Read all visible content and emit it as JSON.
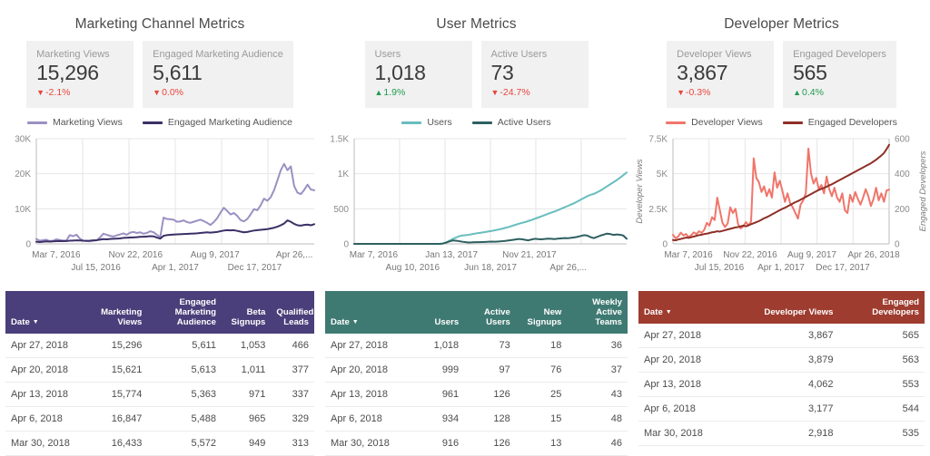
{
  "panels": [
    {
      "title": "Marketing Channel Metrics",
      "accent": "#4a3f7a",
      "kpis": [
        {
          "label": "Marketing Views",
          "value": "15,296",
          "delta": "-2.1%",
          "direction": "down",
          "arrow": "▼"
        },
        {
          "label": "Engaged Marketing Audience",
          "value": "5,611",
          "delta": "0.0%",
          "direction": "down",
          "arrow": "▼"
        }
      ],
      "legend": [
        {
          "label": "Marketing Views",
          "color": "#9b90c2"
        },
        {
          "label": "Engaged Marketing Audience",
          "color": "#3b2f66"
        }
      ],
      "table": {
        "columns": [
          "Date",
          "Marketing Views",
          "Engaged Marketing Audience",
          "Beta Signups",
          "Qualified Leads"
        ],
        "sort_column": "Date",
        "sort_caret": "▼",
        "rows": [
          [
            "Apr 27, 2018",
            "15,296",
            "5,611",
            "1,053",
            "466"
          ],
          [
            "Apr 20, 2018",
            "15,621",
            "5,613",
            "1,011",
            "377"
          ],
          [
            "Apr 13, 2018",
            "15,774",
            "5,363",
            "971",
            "337"
          ],
          [
            "Apr 6, 2018",
            "16,847",
            "5,488",
            "965",
            "329"
          ],
          [
            "Mar 30, 2018",
            "16,433",
            "5,572",
            "949",
            "313"
          ]
        ]
      }
    },
    {
      "title": "User Metrics",
      "accent": "#3f7a72",
      "kpis": [
        {
          "label": "Users",
          "value": "1,018",
          "delta": "1.9%",
          "direction": "up",
          "arrow": "▲"
        },
        {
          "label": "Active Users",
          "value": "73",
          "delta": "-24.7%",
          "direction": "down",
          "arrow": "▼"
        }
      ],
      "legend": [
        {
          "label": "Users",
          "color": "#68bdbd"
        },
        {
          "label": "Active Users",
          "color": "#2e5f60"
        }
      ],
      "table": {
        "columns": [
          "Date",
          "Users",
          "Active Users",
          "New Signups",
          "Weekly Active Teams"
        ],
        "sort_column": "Date",
        "sort_caret": "▼",
        "rows": [
          [
            "Apr 27, 2018",
            "1,018",
            "73",
            "18",
            "36"
          ],
          [
            "Apr 20, 2018",
            "999",
            "97",
            "76",
            "37"
          ],
          [
            "Apr 13, 2018",
            "961",
            "126",
            "25",
            "43"
          ],
          [
            "Apr 6, 2018",
            "934",
            "128",
            "15",
            "48"
          ],
          [
            "Mar 30, 2018",
            "916",
            "126",
            "13",
            "46"
          ]
        ]
      }
    },
    {
      "title": "Developer Metrics",
      "accent": "#9e3c2f",
      "kpis": [
        {
          "label": "Developer Views",
          "value": "3,867",
          "delta": "-0.3%",
          "direction": "down",
          "arrow": "▼"
        },
        {
          "label": "Engaged Developers",
          "value": "565",
          "delta": "0.4%",
          "direction": "up",
          "arrow": "▲"
        }
      ],
      "legend": [
        {
          "label": "Developer Views",
          "color": "#f0756a"
        },
        {
          "label": "Engaged Developers",
          "color": "#8f2f26"
        }
      ],
      "table": {
        "columns": [
          "Date",
          "Developer Views",
          "Engaged Developers"
        ],
        "sort_column": "Date",
        "sort_caret": "▼",
        "rows": [
          [
            "Apr 27, 2018",
            "3,867",
            "565"
          ],
          [
            "Apr 20, 2018",
            "3,879",
            "563"
          ],
          [
            "Apr 13, 2018",
            "4,062",
            "553"
          ],
          [
            "Apr 6, 2018",
            "3,177",
            "544"
          ],
          [
            "Mar 30, 2018",
            "2,918",
            "535"
          ]
        ]
      }
    }
  ],
  "chart_data": [
    {
      "type": "line",
      "title": "Marketing Channel Metrics",
      "xlabel": "",
      "ylabel": "",
      "ylim": [
        0,
        30000
      ],
      "yticks": [
        0,
        10000,
        20000,
        30000
      ],
      "ytick_labels": [
        "0",
        "10K",
        "20K",
        "30K"
      ],
      "grid": true,
      "legend_position": "top",
      "xtick_labels_row1": [
        "Mar 7, 2016",
        "Nov 22, 2016",
        "Aug 9, 2017",
        "Apr 26,..."
      ],
      "xtick_labels_row2": [
        "Jul 15, 2016",
        "Apr 1, 2017",
        "Dec 17, 2017"
      ],
      "series": [
        {
          "name": "Marketing Views",
          "color": "#9b90c2",
          "values": [
            1400,
            900,
            1050,
            1200,
            800,
            900,
            1300,
            1100,
            950,
            1000,
            2500,
            2200,
            2600,
            1500,
            900,
            800,
            700,
            900,
            1000,
            1800,
            2900,
            2600,
            2300,
            2100,
            2400,
            2700,
            3000,
            2600,
            3200,
            3400,
            3100,
            3300,
            2900,
            3100,
            3600,
            3300,
            2600,
            1900,
            7500,
            7100,
            7000,
            6900,
            6300,
            6400,
            6700,
            6200,
            6000,
            6300,
            6600,
            6900,
            6500,
            6000,
            5400,
            6200,
            7300,
            8900,
            10300,
            9400,
            8400,
            8800,
            8000,
            6800,
            6400,
            7100,
            8400,
            9900,
            9600,
            11000,
            12900,
            12300,
            13300,
            15300,
            18100,
            21000,
            22800,
            21000,
            22100,
            16500,
            14600,
            14200,
            15400,
            16900,
            15500,
            15296
          ]
        },
        {
          "name": "Engaged Marketing Audience",
          "color": "#3b2f66",
          "values": [
            600,
            520,
            600,
            700,
            640,
            700,
            780,
            800,
            760,
            800,
            900,
            950,
            1000,
            980,
            900,
            880,
            920,
            1000,
            1050,
            1200,
            1350,
            1300,
            1400,
            1450,
            1500,
            1550,
            1700,
            1750,
            1800,
            1850,
            1900,
            2000,
            2050,
            2100,
            2200,
            2150,
            1800,
            1500,
            2300,
            2500,
            2600,
            2650,
            2700,
            2750,
            2800,
            2850,
            2900,
            2950,
            3000,
            3100,
            3200,
            3300,
            3200,
            3300,
            3400,
            3600,
            3800,
            3900,
            3850,
            3900,
            3700,
            3500,
            3300,
            3400,
            3600,
            3800,
            3900,
            4000,
            4100,
            4200,
            4400,
            4600,
            4900,
            5300,
            5800,
            6700,
            6300,
            5700,
            5300,
            5200,
            5400,
            5500,
            5300,
            5611
          ]
        }
      ]
    },
    {
      "type": "line",
      "title": "User Metrics",
      "xlabel": "",
      "ylabel": "",
      "ylim": [
        0,
        1500
      ],
      "yticks": [
        0,
        500,
        1000,
        1500
      ],
      "ytick_labels": [
        "0",
        "500",
        "1K",
        "1.5K"
      ],
      "grid": true,
      "legend_position": "top",
      "xtick_labels_row1": [
        "Mar 7, 2016",
        "Jan 13, 2017",
        "Nov 21, 2017",
        ""
      ],
      "xtick_labels_row2": [
        "Aug 10, 2016",
        "Jun 18, 2017",
        "Apr 26,..."
      ],
      "series": [
        {
          "name": "Users",
          "color": "#68bdbd",
          "values": [
            0,
            0,
            0,
            0,
            0,
            0,
            0,
            0,
            0,
            0,
            0,
            0,
            0,
            0,
            0,
            0,
            0,
            0,
            0,
            0,
            0,
            0,
            0,
            0,
            0,
            0,
            0,
            5,
            20,
            45,
            70,
            90,
            110,
            120,
            125,
            130,
            140,
            148,
            155,
            162,
            170,
            178,
            186,
            195,
            205,
            215,
            228,
            240,
            255,
            270,
            285,
            298,
            310,
            325,
            340,
            358,
            375,
            392,
            410,
            428,
            445,
            462,
            480,
            500,
            520,
            540,
            560,
            580,
            605,
            630,
            655,
            680,
            700,
            712,
            735,
            760,
            790,
            820,
            850,
            880,
            910,
            945,
            980,
            1018
          ]
        },
        {
          "name": "Active Users",
          "color": "#2e5f60",
          "values": [
            0,
            0,
            0,
            0,
            0,
            0,
            0,
            0,
            0,
            0,
            0,
            0,
            0,
            0,
            0,
            0,
            0,
            0,
            0,
            0,
            0,
            0,
            0,
            0,
            0,
            0,
            0,
            4,
            18,
            35,
            48,
            45,
            38,
            30,
            24,
            20,
            22,
            25,
            24,
            26,
            28,
            30,
            32,
            30,
            34,
            38,
            42,
            48,
            55,
            62,
            70,
            66,
            58,
            50,
            62,
            72,
            68,
            64,
            70,
            75,
            72,
            68,
            74,
            78,
            82,
            80,
            86,
            92,
            100,
            112,
            124,
            118,
            96,
            82,
            100,
            118,
            132,
            146,
            140,
            128,
            134,
            130,
            118,
            73
          ]
        }
      ]
    },
    {
      "type": "line",
      "title": "Developer Metrics",
      "xlabel": "",
      "ylabel": "Developer Views",
      "ylabel_right": "Engaged Developers",
      "ylim": [
        0,
        7500
      ],
      "yticks": [
        0,
        2500,
        5000,
        7500
      ],
      "ytick_labels": [
        "0",
        "2.5K",
        "5K",
        "7.5K"
      ],
      "ylim_right": [
        0,
        600
      ],
      "yticks_right": [
        0,
        200,
        400,
        600
      ],
      "ytick_labels_right": [
        "0",
        "200",
        "400",
        "600"
      ],
      "grid": true,
      "legend_position": "top",
      "xtick_labels_row1": [
        "Mar 7, 2016",
        "Nov 22, 2016",
        "Aug 9, 2017",
        "Apr 26, 2018"
      ],
      "xtick_labels_row2": [
        "Jul 15, 2016",
        "Apr 1, 2017",
        "Dec 17, 2017"
      ],
      "series": [
        {
          "name": "Developer Views",
          "color": "#f0756a",
          "axis": "left",
          "values": [
            650,
            400,
            520,
            800,
            600,
            700,
            480,
            620,
            820,
            700,
            900,
            780,
            1000,
            1500,
            1300,
            1900,
            1700,
            3300,
            2400,
            1500,
            1200,
            1450,
            2600,
            2200,
            2500,
            1400,
            1100,
            1250,
            1550,
            1300,
            1600,
            6100,
            4700,
            4400,
            3700,
            4100,
            3400,
            3900,
            3300,
            5100,
            4000,
            4500,
            3800,
            3000,
            3600,
            2900,
            2600,
            2200,
            1800,
            2800,
            3100,
            3600,
            6800,
            5000,
            4300,
            4700,
            3900,
            4200,
            3600,
            4800,
            3900,
            3400,
            4000,
            3300,
            3000,
            3600,
            2400,
            2200,
            3500,
            3000,
            3700,
            3200,
            2800,
            3300,
            3900,
            3400,
            2700,
            3200,
            4000,
            3100,
            3600,
            3000,
            3800,
            3867
          ]
        },
        {
          "name": "Engaged Developers",
          "color": "#8f2f26",
          "axis": "right",
          "values": [
            22,
            20,
            25,
            28,
            32,
            36,
            34,
            38,
            42,
            46,
            50,
            52,
            56,
            58,
            62,
            66,
            68,
            72,
            70,
            74,
            78,
            82,
            86,
            90,
            94,
            96,
            100,
            104,
            100,
            106,
            112,
            118,
            124,
            130,
            138,
            146,
            152,
            160,
            168,
            176,
            184,
            192,
            200,
            206,
            214,
            222,
            230,
            238,
            244,
            252,
            260,
            268,
            276,
            284,
            292,
            300,
            308,
            314,
            320,
            326,
            334,
            340,
            348,
            356,
            364,
            372,
            380,
            388,
            396,
            404,
            412,
            420,
            428,
            436,
            444,
            452,
            460,
            470,
            480,
            492,
            504,
            518,
            540,
            565
          ]
        }
      ]
    }
  ]
}
